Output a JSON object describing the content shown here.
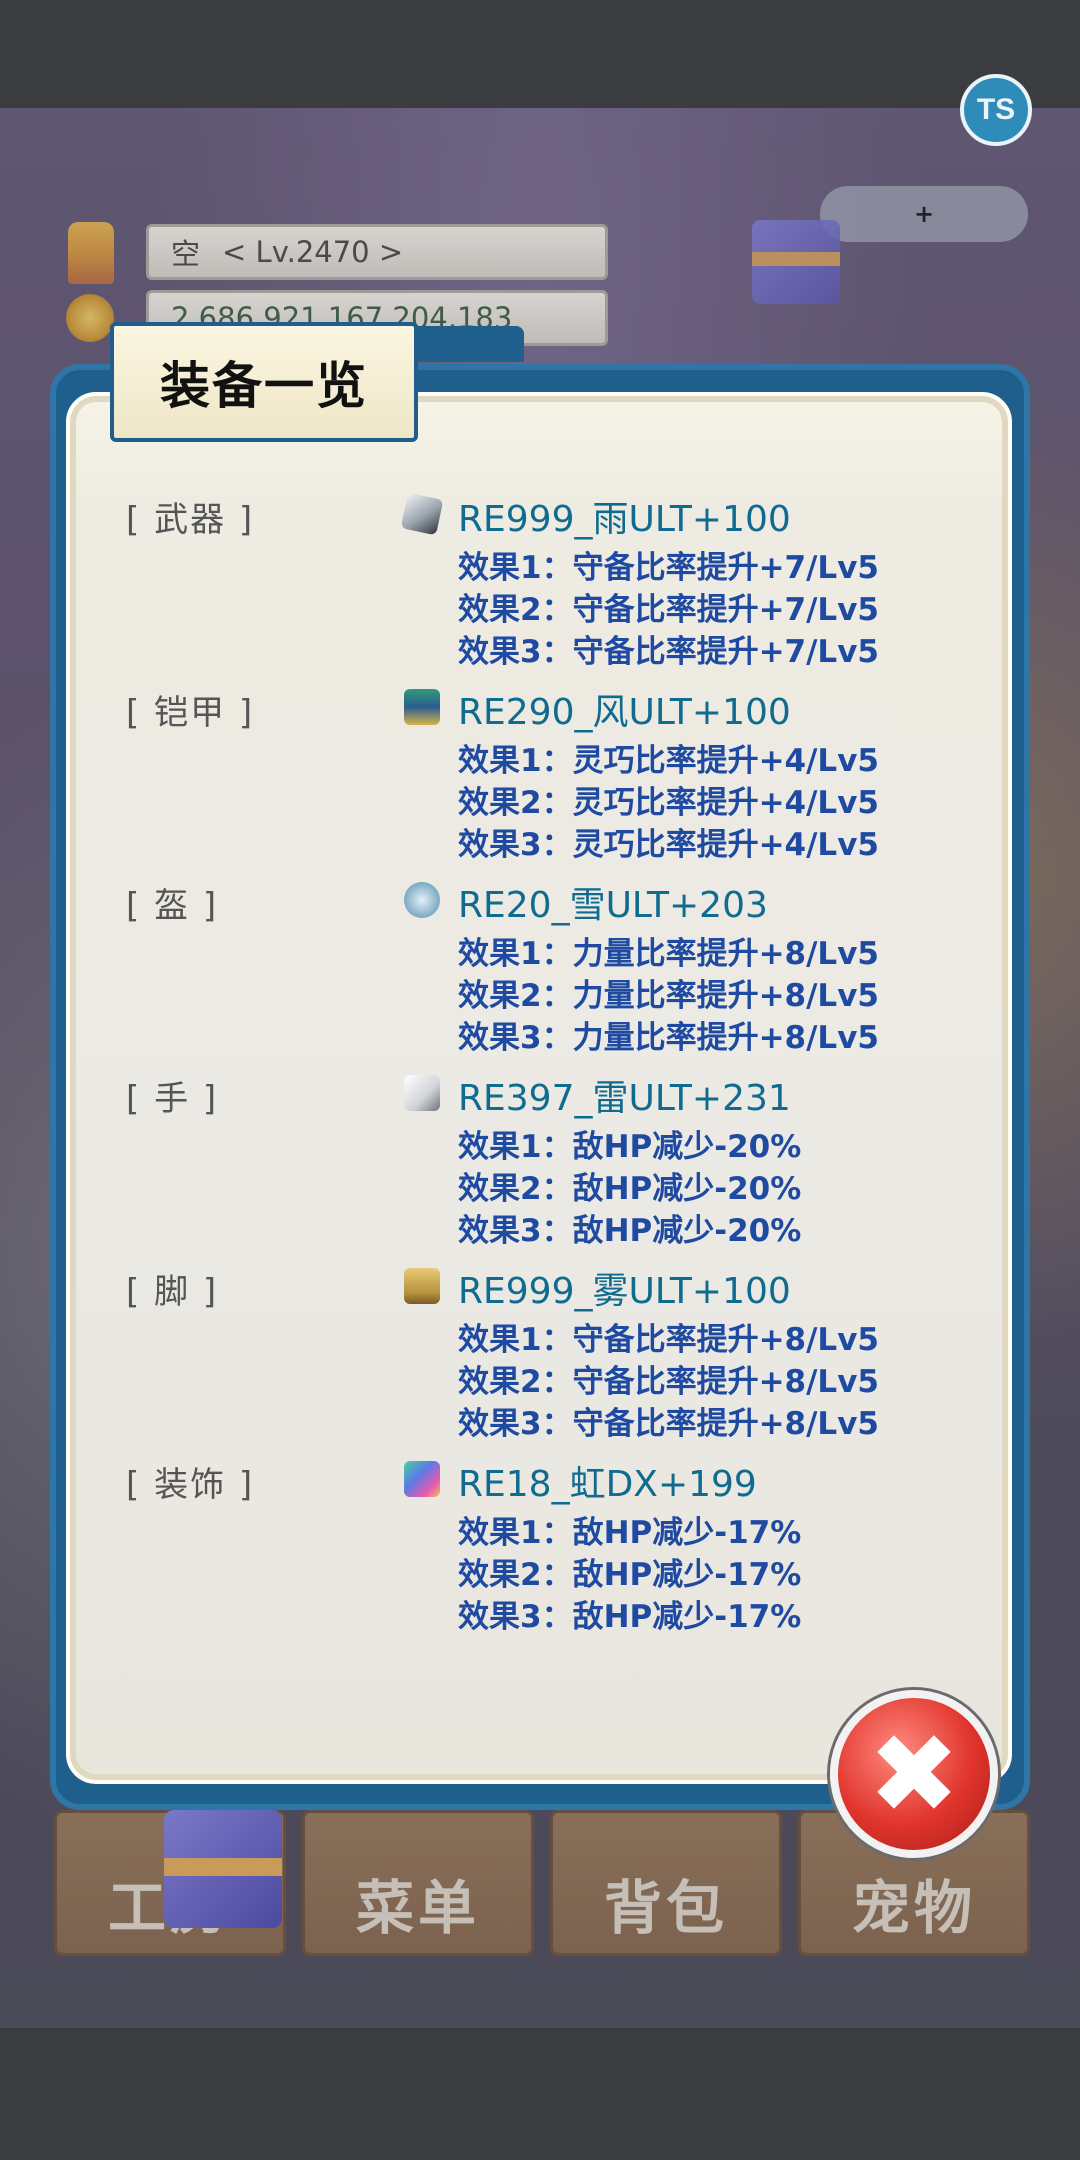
{
  "hud": {
    "player_name": "空",
    "player_level": "< Lv.2470 >",
    "gold": "2,686,921,167,204,183",
    "ts_label": "TS"
  },
  "panel": {
    "title": "装备一览",
    "items": [
      {
        "slot": "[ 武器 ]",
        "icon": "sword-icon",
        "name": "RE999_雨ULT+100",
        "effects": [
          "效果1：守备比率提升+7/Lv5",
          "效果2：守备比率提升+7/Lv5",
          "效果3：守备比率提升+7/Lv5"
        ]
      },
      {
        "slot": "[ 铠甲 ]",
        "icon": "armor-icon",
        "name": "RE290_风ULT+100",
        "effects": [
          "效果1：灵巧比率提升+4/Lv5",
          "效果2：灵巧比率提升+4/Lv5",
          "效果3：灵巧比率提升+4/Lv5"
        ]
      },
      {
        "slot": "[ 盔 ]",
        "icon": "helmet-icon",
        "name": "RE20_雪ULT+203",
        "effects": [
          "效果1：力量比率提升+8/Lv5",
          "效果2：力量比率提升+8/Lv5",
          "效果3：力量比率提升+8/Lv5"
        ]
      },
      {
        "slot": "[ 手 ]",
        "icon": "glove-icon",
        "name": "RE397_雷ULT+231",
        "effects": [
          "效果1：敌HP减少-20%",
          "效果2：敌HP减少-20%",
          "效果3：敌HP减少-20%"
        ]
      },
      {
        "slot": "[ 脚 ]",
        "icon": "boot-icon",
        "name": "RE999_雾ULT+100",
        "effects": [
          "效果1：守备比率提升+8/Lv5",
          "效果2：守备比率提升+8/Lv5",
          "效果3：守备比率提升+8/Lv5"
        ]
      },
      {
        "slot": "[ 装饰 ]",
        "icon": "accessory-icon",
        "name": "RE18_虹DX+199",
        "effects": [
          "效果1：敌HP减少-17%",
          "效果2：敌HP减少-17%",
          "效果3：敌HP减少-17%"
        ]
      }
    ],
    "close_symbol": "✖"
  },
  "bottom_menu": {
    "items": [
      "工房",
      "菜单",
      "背包",
      "宠物"
    ]
  }
}
